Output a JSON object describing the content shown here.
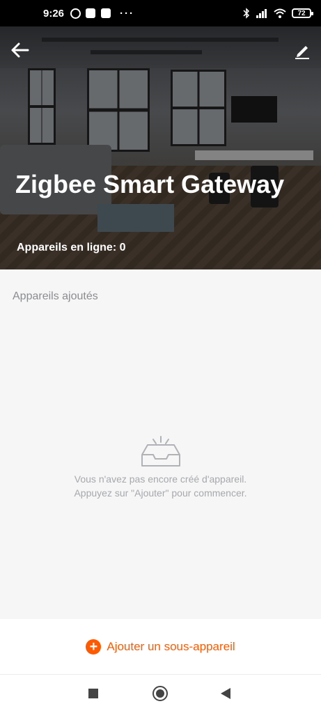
{
  "status_bar": {
    "time": "9:26",
    "app_icons": [
      "whatsapp-icon",
      "message-icon",
      "app-icon"
    ],
    "dots": "···",
    "battery": "72",
    "right_icons": [
      "bluetooth-icon",
      "signal-icon",
      "wifi-icon"
    ]
  },
  "header": {
    "title": "Zigbee Smart Gateway",
    "online_label": "Appareils en ligne: 0",
    "back_icon": "arrow-left-icon",
    "edit_icon": "pencil-icon"
  },
  "main": {
    "section_title": "Appareils ajoutés",
    "empty_icon": "empty-box-icon",
    "empty_line1": "Vous n'avez pas encore créé d'appareil.",
    "empty_line2": "Appuyez sur \"Ajouter\" pour commencer."
  },
  "actions": {
    "add_label": "Ajouter un sous-appareil",
    "add_icon": "+"
  },
  "colors": {
    "accent": "#ff5a00",
    "muted_text": "#a6a8ac",
    "background": "#f6f6f6"
  }
}
